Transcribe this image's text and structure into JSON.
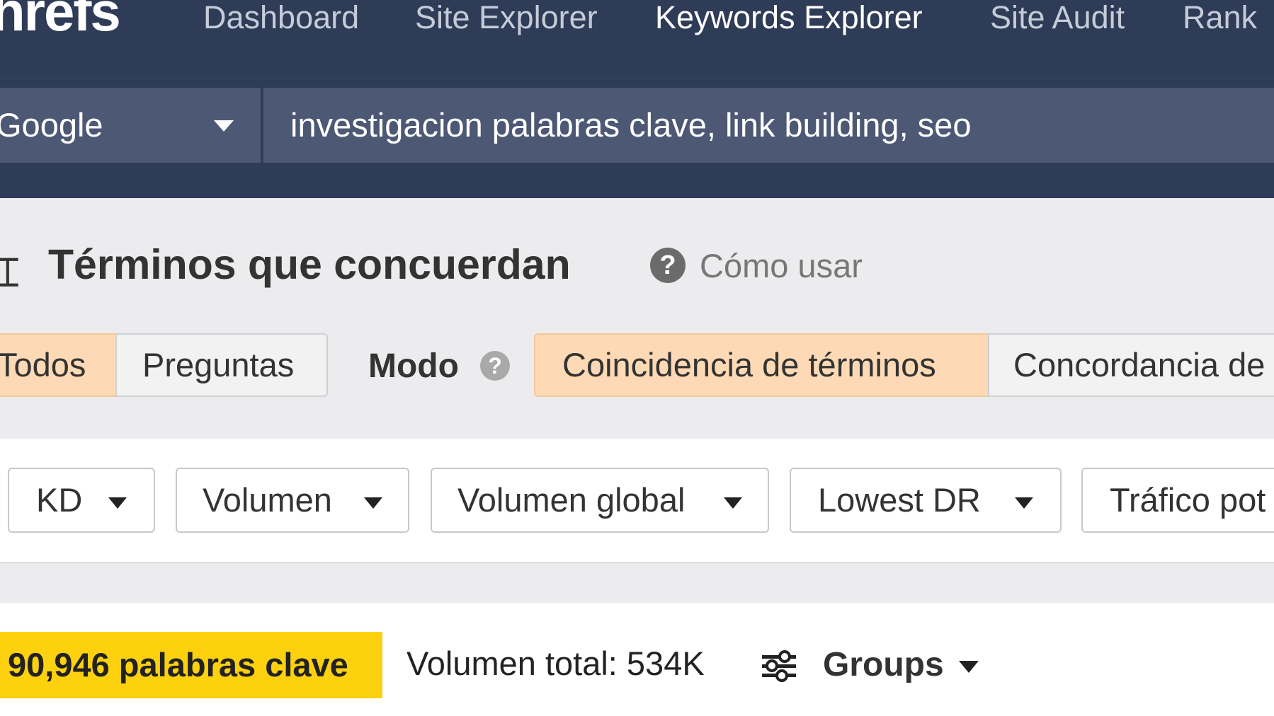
{
  "topnav": {
    "logo_text": "hrefs",
    "items": [
      {
        "label": "Dashboard",
        "active": false
      },
      {
        "label": "Site Explorer",
        "active": false
      },
      {
        "label": "Keywords Explorer",
        "active": true
      },
      {
        "label": "Site Audit",
        "active": false
      },
      {
        "label": "Rank",
        "active": false
      }
    ]
  },
  "search": {
    "engine": "Google",
    "query": "investigacion palabras clave, link building, seo"
  },
  "report": {
    "title": "Términos que concuerdan",
    "help_icon": "question-circle-icon",
    "how_to_use": "Cómo usar",
    "tabs": [
      {
        "label": "Todos",
        "selected": true
      },
      {
        "label": "Preguntas",
        "selected": false
      }
    ],
    "mode_label": "Modo",
    "modes": [
      {
        "label": "Coincidencia de términos",
        "selected": true
      },
      {
        "label": "Concordancia de",
        "selected": false
      }
    ]
  },
  "filters": [
    {
      "label": "KD"
    },
    {
      "label": "Volumen"
    },
    {
      "label": "Volumen global"
    },
    {
      "label": "Lowest DR"
    },
    {
      "label": "Tráfico pot"
    }
  ],
  "summary": {
    "keywords_count": "90,946 palabras clave",
    "total_volume": "Volumen total: 534K",
    "groups_icon": "sliders-icon",
    "groups_label": "Groups"
  },
  "colors": {
    "nav_bg": "#2f3c57",
    "search_field_bg": "#4c5874",
    "selected_tab_bg": "#fddab5",
    "keyword_badge_bg": "#fdd10e"
  }
}
